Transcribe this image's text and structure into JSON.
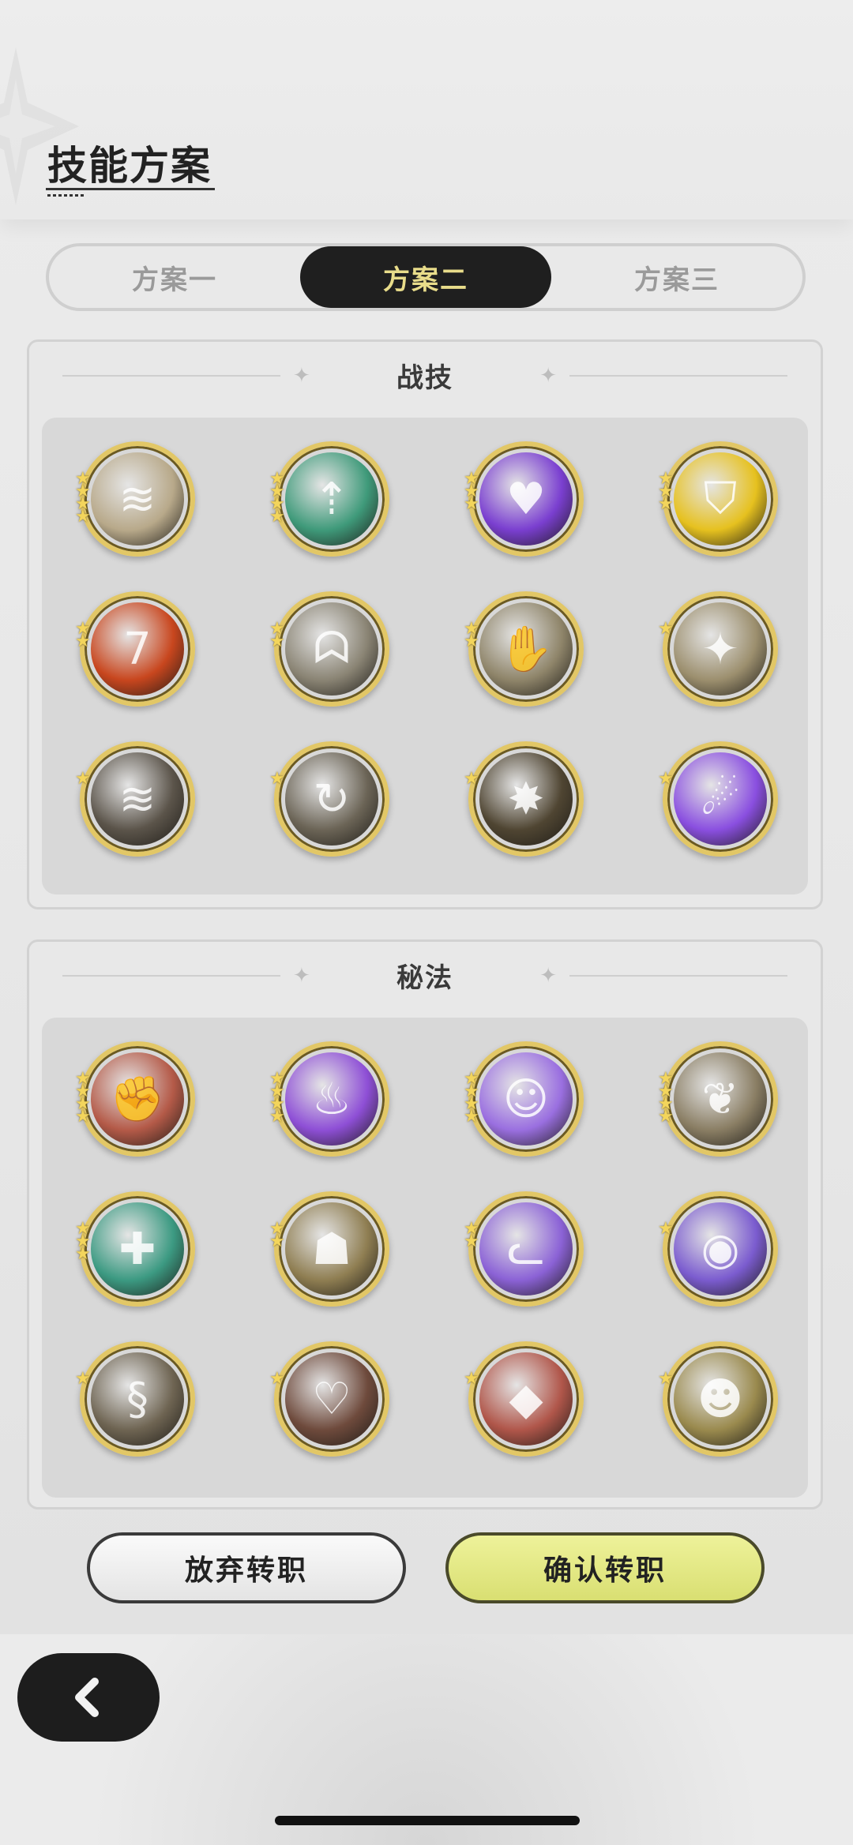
{
  "header": {
    "title": "技能方案"
  },
  "tabs": [
    {
      "label": "方案一",
      "active": false
    },
    {
      "label": "方案二",
      "active": true
    },
    {
      "label": "方案三",
      "active": false
    }
  ],
  "combat_skills": {
    "title": "战技",
    "skills": [
      {
        "icon": "wind-slash-icon",
        "stars": 4,
        "color": "#b8a98a"
      },
      {
        "icon": "green-arrows-up-icon",
        "stars": 4,
        "color": "#3f9a7a"
      },
      {
        "icon": "purple-heart-icon",
        "stars": 3,
        "color": "#7a3fd0"
      },
      {
        "icon": "golden-shield-icon",
        "stars": 3,
        "color": "#e6c11f"
      },
      {
        "icon": "fire-number-seven-icon",
        "stars": 2,
        "color": "#c8461e"
      },
      {
        "icon": "beast-silhouette-icon",
        "stars": 2,
        "color": "#8a8474"
      },
      {
        "icon": "palm-strike-icon",
        "stars": 2,
        "color": "#8f856a"
      },
      {
        "icon": "sword-burst-icon",
        "stars": 1,
        "color": "#9c8f6e"
      },
      {
        "icon": "triple-slash-icon",
        "stars": 1,
        "color": "#5b544a"
      },
      {
        "icon": "spiral-slash-icon",
        "stars": 1,
        "color": "#6b6456"
      },
      {
        "icon": "explosion-burst-icon",
        "stars": 1,
        "color": "#4f4532"
      },
      {
        "icon": "purple-comet-icon",
        "stars": 1,
        "color": "#8a4fe0"
      }
    ]
  },
  "secret_arts": {
    "title": "秘法",
    "skills": [
      {
        "icon": "red-fist-icon",
        "stars": 4,
        "color": "#b45a48"
      },
      {
        "icon": "purple-flame-icon",
        "stars": 4,
        "color": "#8e4fd6"
      },
      {
        "icon": "purple-figure-icon",
        "stars": 4,
        "color": "#9a6fe0"
      },
      {
        "icon": "maple-leaf-icon",
        "stars": 4,
        "color": "#8a7e64"
      },
      {
        "icon": "teal-heal-icon",
        "stars": 3,
        "color": "#3c9a82"
      },
      {
        "icon": "golem-icon",
        "stars": 2,
        "color": "#8f7e52"
      },
      {
        "icon": "purple-wolf-icon",
        "stars": 2,
        "color": "#8b62d6"
      },
      {
        "icon": "purple-orb-icon",
        "stars": 1,
        "color": "#7b5ccf"
      },
      {
        "icon": "serpent-icon",
        "stars": 1,
        "color": "#6e6452"
      },
      {
        "icon": "heart-shield-icon",
        "stars": 1,
        "color": "#6e4a3c"
      },
      {
        "icon": "red-rock-icon",
        "stars": 1,
        "color": "#b0564a"
      },
      {
        "icon": "golden-spirit-icon",
        "stars": 1,
        "color": "#9a8a4e"
      }
    ]
  },
  "buttons": {
    "abandon": "放弃转职",
    "confirm": "确认转职"
  },
  "colors": {
    "accent_tab_text": "#e8dc8a",
    "confirm_button": "#d9df72",
    "frame_gold": "#e2c766"
  }
}
